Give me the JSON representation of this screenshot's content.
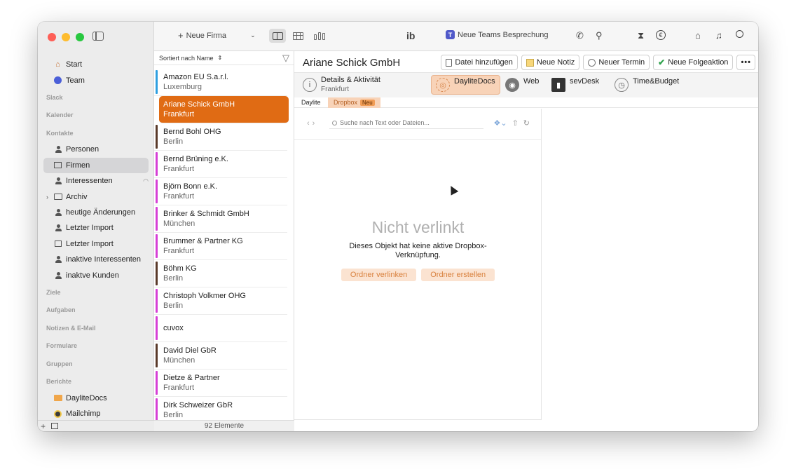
{
  "sidebar": {
    "top_items": [
      {
        "label": "Start",
        "icon": "home-icon"
      },
      {
        "label": "Team",
        "icon": "team-icon"
      }
    ],
    "sections": {
      "slack": "Slack",
      "kalender": "Kalender",
      "kontakte": "Kontakte",
      "ziele": "Ziele",
      "aufgaben": "Aufgaben",
      "notizen": "Notizen & E-Mail",
      "formulare": "Formulare",
      "gruppen": "Gruppen",
      "berichte": "Berichte"
    },
    "contacts": [
      {
        "label": "Personen"
      },
      {
        "label": "Firmen"
      },
      {
        "label": "Interessenten"
      },
      {
        "label": "Archiv"
      },
      {
        "label": "heutige Änderungen"
      },
      {
        "label": "Letzter Import"
      },
      {
        "label": "Letzter Import"
      },
      {
        "label": "inaktive Interessenten"
      },
      {
        "label": "inaktve Kunden"
      }
    ],
    "reports": [
      {
        "label": "DayliteDocs"
      },
      {
        "label": "Mailchimp"
      }
    ]
  },
  "toolbar": {
    "new_company": "Neue Firma",
    "teams_meeting": "Neue Teams Besprechung"
  },
  "list": {
    "sort_label": "Sortiert nach Name",
    "footer": "92 Elemente",
    "rows": [
      {
        "name": "Amazon EU S.a.r.l.",
        "city": "Luxemburg",
        "color": "#2e9fe0"
      },
      {
        "name": "Ariane Schick GmbH",
        "city": "Frankfurt",
        "color": "#e06b14"
      },
      {
        "name": "Bernd Bohl OHG",
        "city": "Berlin",
        "color": "#5a3a2a"
      },
      {
        "name": "Bernd Brüning e.K.",
        "city": "Frankfurt",
        "color": "#d63fd6"
      },
      {
        "name": "Björn Bonn e.K.",
        "city": "Frankfurt",
        "color": "#d63fd6"
      },
      {
        "name": "Brinker & Schmidt GmbH",
        "city": "München",
        "color": "#d63fd6"
      },
      {
        "name": "Brummer & Partner KG",
        "city": "Frankfurt",
        "color": "#d63fd6"
      },
      {
        "name": "Böhm KG",
        "city": "Berlin",
        "color": "#5a3a2a"
      },
      {
        "name": "Christoph Volkmer OHG",
        "city": "Berlin",
        "color": "#d63fd6"
      },
      {
        "name": "cuvox",
        "city": "",
        "color": "#d63fd6"
      },
      {
        "name": "David Diel GbR",
        "city": "München",
        "color": "#5a3a2a"
      },
      {
        "name": "Dietze & Partner",
        "city": "Frankfurt",
        "color": "#d63fd6"
      },
      {
        "name": "Dirk Schweizer GbR",
        "city": "Berlin",
        "color": "#d63fd6"
      }
    ]
  },
  "detail": {
    "title": "Ariane Schick GmbH",
    "actions": {
      "add_file": "Datei hinzufügen",
      "new_note": "Neue Notiz",
      "new_appointment": "Neuer Termin",
      "new_followup": "Neue Folgeaktion",
      "more": "•••"
    },
    "tabs": {
      "details": "Details & Aktivität",
      "details_sub": "Frankfurt",
      "daylitedocs": "DayliteDocs",
      "web": "Web",
      "sevdesk": "sevDesk",
      "timebudget": "Time&Budget"
    },
    "subtabs": {
      "daylite": "Daylite",
      "dropbox": "Dropbox",
      "new_badge": "Neu"
    },
    "search_placeholder": "Suche nach Text oder Dateien...",
    "empty": {
      "title": "Nicht verlinkt",
      "text": "Dieses Objekt hat keine aktive Dropbox-Verknüpfung.",
      "link_button": "Ordner verlinken",
      "create_button": "Ordner erstellen"
    }
  }
}
